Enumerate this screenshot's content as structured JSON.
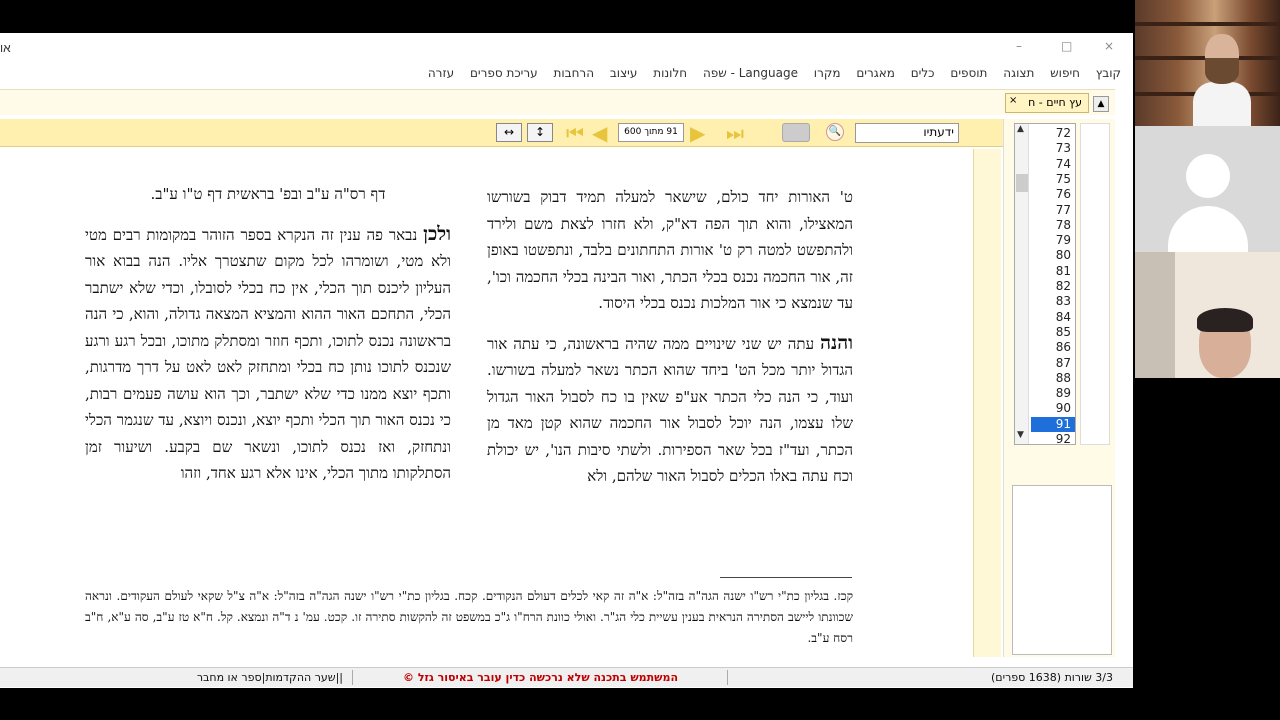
{
  "titlebar": {
    "left_text": "או",
    "minimize": "–",
    "maximize": "□",
    "close": "×"
  },
  "menu": [
    "קובץ",
    "חיפוש",
    "תצוגה",
    "תוספים",
    "כלים",
    "מאגרים",
    "מקרו",
    "Language - שפה",
    "חלונות",
    "עיצוב",
    "הרחבות",
    "עריכת ספרים",
    "עזרה"
  ],
  "tab": {
    "label": "עץ חיים - ח",
    "close": "×"
  },
  "toolbar": {
    "fit_width": "↔",
    "fit_height": "↕",
    "page_display": "91 מתוך 600",
    "search_value": "ידעתיו"
  },
  "reader": {
    "right_col": {
      "p1": "ט' האורות יחד כולם, שישאר למעלה תמיד דבוק בשורשו המאצילו, והוא תוך הפה דא\"ק, ולא חזרו לצאת משם ולירד ולהתפשט למטה רק ט' אורות התחתונים בלבד, ונתפשטו באופן זה, אור החכמה נכנס בכלי הכתר, ואור הבינה בכלי החכמה וכו', עד שנמצא כי אור המלכות נכנס בכלי היסוד.",
      "p2_lead": "והנה",
      "p2": "עתה יש שני שינויים ממה שהיה בראשונה, כי עתה אור הגדול יותר מכל הט' ביחד שהוא הכתר נשאר למעלה בשורשו. ועוד, כי הנה כלי הכתר אע\"פ שאין בו כח לסבול האור הגדול שלו עצמו, הנה יוכל לסבול אור החכמה שהוא קטן מאד מן הכתר, ועד\"ז בכל שאר הספירות. ולשתי סיבות הנו', יש יכולת וכח עתה באלו הכלים לסבול האור שלהם, ולא"
    },
    "left_col": {
      "ref": "דף רס\"ה ע\"ב ובפ' בראשית דף ט\"ו ע\"ב.",
      "p_lead": "ולכן",
      "p": "נבאר פה ענין זה הנקרא בספר הזוהר במקומות רבים מטי ולא מטי, ושומרהו לכל מקום שתצטרך אליו. הנה בבוא אור העליון ליכנס תוך הכלי, אין כח בכלי לסובלו, וכדי שלא ישתבר הכלי, התחכם האור ההוא והמציא המצאה גדולה, והוא, כי הנה בראשונה נכנס לתוכו, ותכף חוזר ומסתלק מתוכו, ובכל רגע ורגע שנכנס לתוכו נותן כח בכלי ומתחזק לאט לאט על דרך מדרגות, ותכף יוצא ממנו כדי שלא ישתבר, וכך הוא עושה פעמים רבות, כי נכנס האור תוך הכלי ותכף יוצא, ונכנס ויוצא, עד שנגמר הכלי ונתחזק, ואז נכנס לתוכו, ונשאר שם בקבע. ושיעור זמן הסתלקותו מתוך הכלי, אינו אלא רגע אחד, וזהו"
    },
    "footnotes": "קכז. בגליון כת\"י רש\"ו ישנה הגה\"ה בזה\"ל: א\"ה זה קאי לכלים דעולם הנקודים. קכח. בגליון כת\"י רש\"ו ישנה הגה\"ה בזה\"ל: א\"ה צ\"ל שקאי לעולם העקודים. ונראה שכוונתו ליישב הסתירה הנראית בענין עשיית כלי הג\"ר. ואולי כוונת הרח\"ו ג\"כ במשפט זה להקשות סתירה זו. קכט. עמ' נ ד\"ה ונמצא. קל. ח\"א טז ע\"ב, סה ע\"א, ח\"ב רסח ע\"ב."
  },
  "pagelist": {
    "items": [
      "72",
      "73",
      "74",
      "75",
      "76",
      "77",
      "78",
      "79",
      "80",
      "81",
      "82",
      "83",
      "84",
      "85",
      "86",
      "87",
      "88",
      "89",
      "90",
      "91",
      "92"
    ],
    "selected": "91"
  },
  "status": {
    "lines": "3/3 שורות (1638 ספרים)",
    "warning": "המשתמש בתכנה שלא נרכשה כדין עובר באיסור גזל  ©",
    "path": "||שער ההקדמות|ספר או מחבר"
  },
  "colors": {
    "toolbar_bg": "#fff0b0",
    "selected": "#1e6fd9",
    "warning": "#c00000"
  }
}
